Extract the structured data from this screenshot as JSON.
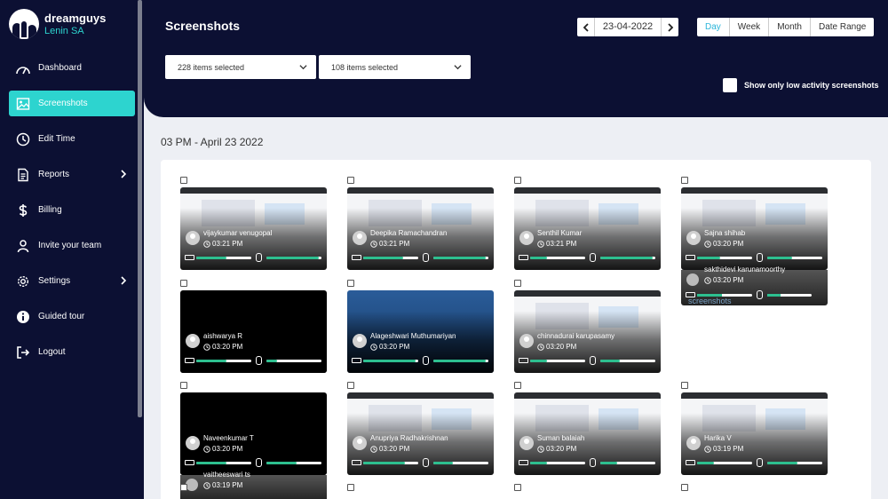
{
  "brand": {
    "name": "dreamguys",
    "user": "Lenin SA"
  },
  "nav": [
    {
      "label": "Dashboard",
      "icon": "dashboard-icon"
    },
    {
      "label": "Screenshots",
      "icon": "image-icon",
      "active": true
    },
    {
      "label": "Edit Time",
      "icon": "clock-icon"
    },
    {
      "label": "Reports",
      "icon": "document-icon",
      "has_submenu": true
    },
    {
      "label": "Billing",
      "icon": "dollar-icon"
    },
    {
      "label": "Invite your team",
      "icon": "user-icon"
    },
    {
      "label": "Settings",
      "icon": "gear-icon",
      "has_submenu": true
    },
    {
      "label": "Guided tour",
      "icon": "info-icon"
    },
    {
      "label": "Logout",
      "icon": "logout-icon"
    }
  ],
  "header": {
    "title": "Screenshots",
    "filter1": "228 items selected",
    "filter2": "108 items selected",
    "date": "23-04-2022",
    "ranges": [
      "Day",
      "Week",
      "Month",
      "Date Range"
    ],
    "active_range": "Day",
    "low_activity_label": "Show only low activity screenshots"
  },
  "section": {
    "heading": "03 PM - April 23 2022"
  },
  "colors": {
    "accent": "#2dd4cf",
    "navy": "#0c1033",
    "progress": "#2dbf8f"
  },
  "cards": [
    {
      "name": "vijaykumar venugopal",
      "time": "03:21 PM",
      "keyboard": 0.55,
      "mouse": 0.95
    },
    {
      "name": "Deepika Ramachandran",
      "time": "03:21 PM",
      "keyboard": 0.72,
      "mouse": 0.95
    },
    {
      "name": "Senthil Kumar",
      "time": "03:21 PM",
      "keyboard": 0.3,
      "mouse": 0.95
    },
    {
      "name": "Sajna shihab",
      "time": "03:20 PM",
      "keyboard": 0.42,
      "mouse": 0.45
    },
    {
      "name": "aishwarya R",
      "time": "03:20 PM",
      "keyboard": 0.55,
      "mouse": 0.2
    },
    {
      "name": "Alageshwari Muthumariyan",
      "time": "03:20 PM",
      "keyboard": 0.95,
      "mouse": 0.95
    },
    {
      "name": "chinnadurai karupasamy",
      "time": "03:20 PM",
      "keyboard": 0.3,
      "mouse": 0.35
    },
    {
      "name": "Naveenkumar T",
      "time": "03:20 PM",
      "keyboard": 0.55,
      "mouse": 0.55
    },
    {
      "name": "Anupriya Radhakrishnan",
      "time": "03:20 PM",
      "keyboard": 0.75,
      "mouse": 0.35
    },
    {
      "name": "Suman balaiah",
      "time": "03:20 PM",
      "keyboard": 0.3,
      "mouse": 0.3
    },
    {
      "name": "Harika V",
      "time": "03:19 PM",
      "keyboard": 0.3,
      "mouse": 0.55
    }
  ],
  "extras": [
    {
      "name": "sakthidevi karunamoorthy",
      "time": "03:20 PM",
      "label": "screenshots"
    },
    {
      "name": "vaitheeswari ts",
      "time": "03:19 PM"
    }
  ]
}
